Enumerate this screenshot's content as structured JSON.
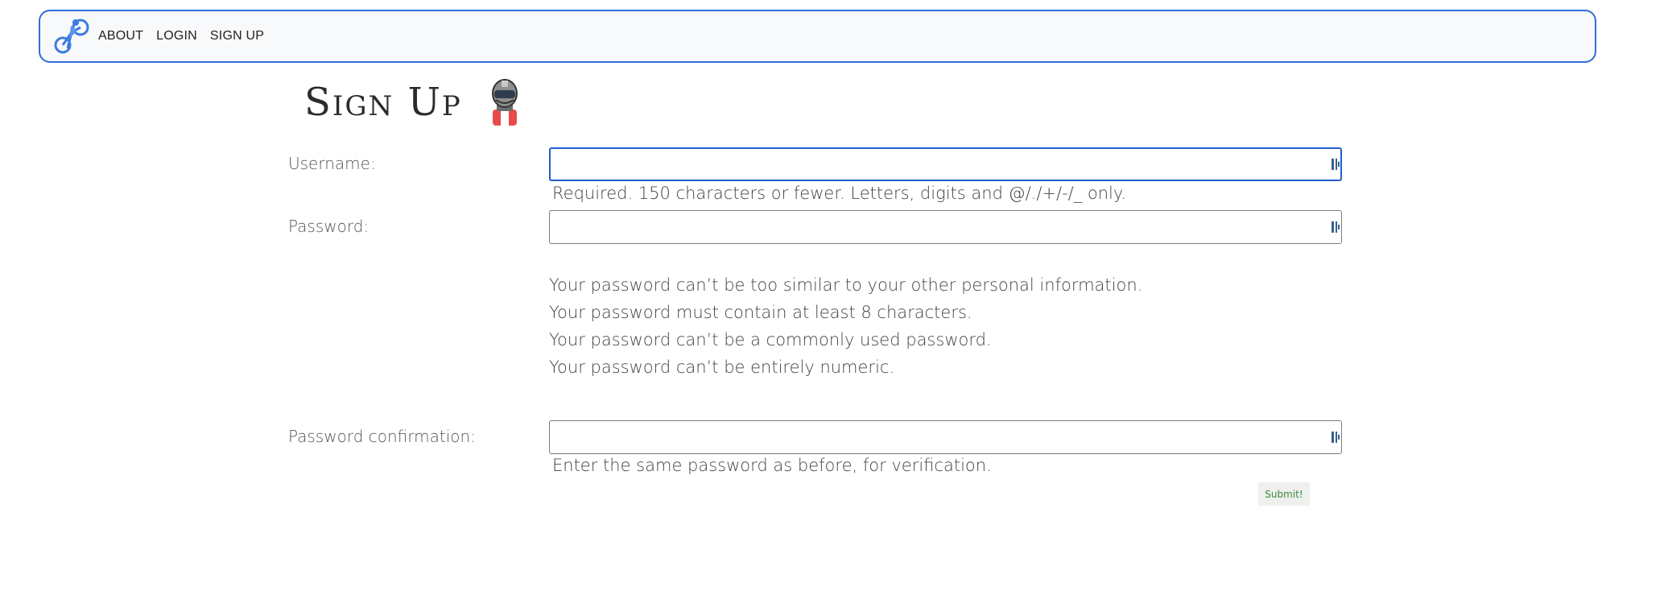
{
  "nav": {
    "links": [
      "ABOUT",
      "LOGIN",
      "SIGN UP"
    ]
  },
  "page": {
    "title": "Sign Up"
  },
  "form": {
    "username": {
      "label": "Username:",
      "value": "",
      "help": "Required. 150 characters or fewer. Letters, digits and @/./+/-/_ only."
    },
    "password": {
      "label": "Password:",
      "value": "",
      "rules": [
        "Your password can’t be too similar to your other personal information.",
        "Your password must contain at least 8 characters.",
        "Your password can’t be a commonly used password.",
        "Your password can’t be entirely numeric."
      ]
    },
    "password_confirmation": {
      "label": "Password confirmation:",
      "value": "",
      "help": "Enter the same password as before, for verification."
    },
    "submit_label": "Submit!"
  },
  "colors": {
    "nav_border": "#2f6fd6",
    "focus_border": "#1f5fcf",
    "submit_text": "#3d8a3d"
  },
  "icons": {
    "brand": "cyclist-logo-icon",
    "avatar": "racer-helmet-icon",
    "field_widget": "password-manager-icon"
  }
}
